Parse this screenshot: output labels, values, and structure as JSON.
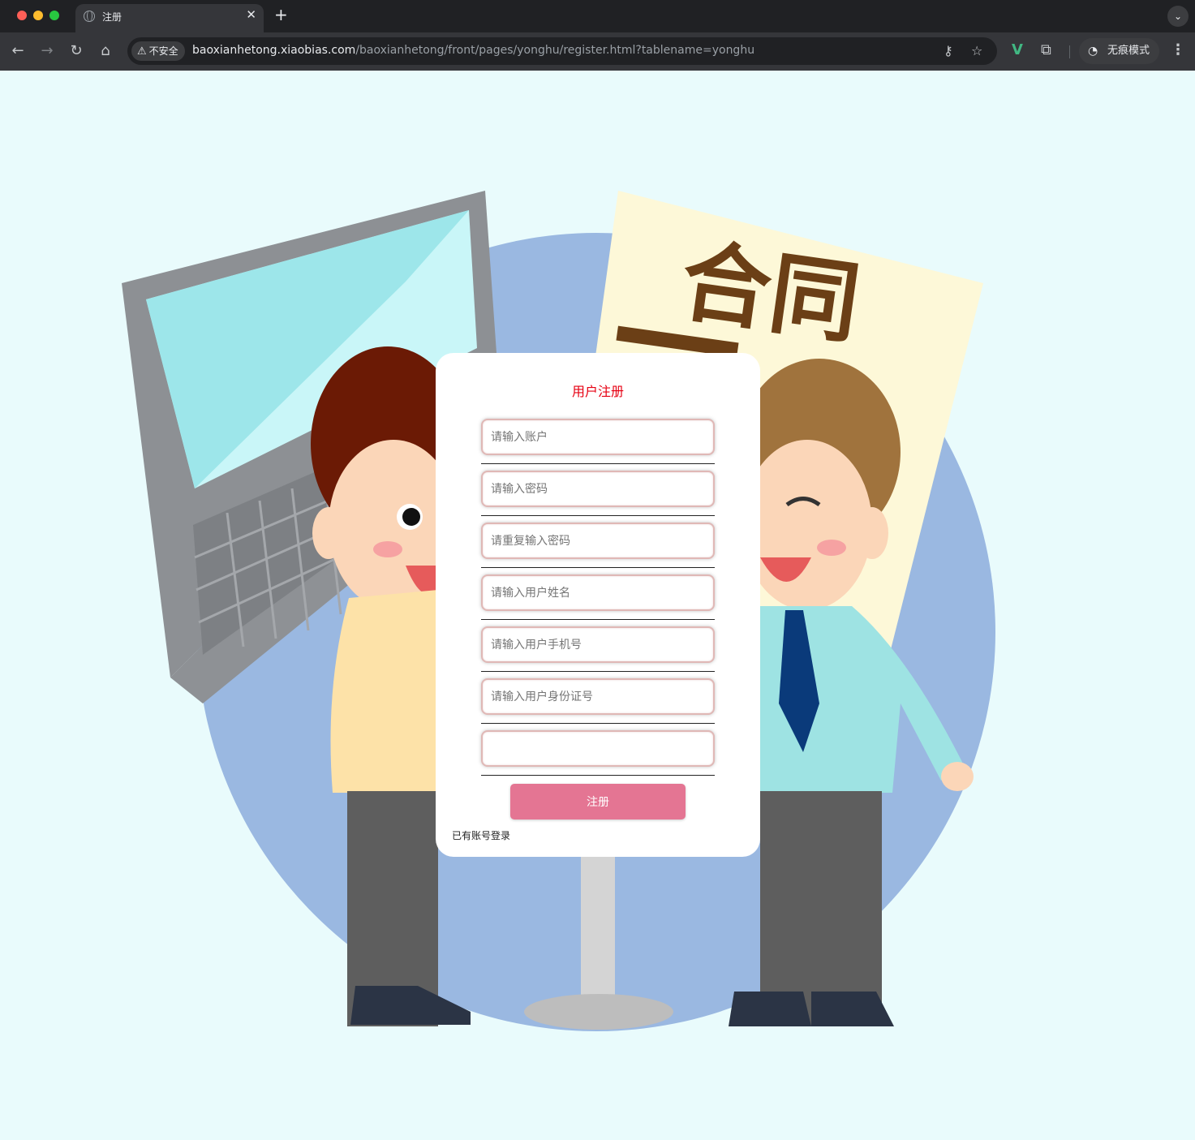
{
  "browser": {
    "tab_title": "注册",
    "tab_close": "✕",
    "new_tab": "+",
    "tab_menu": "⌄",
    "security_label": "不安全",
    "security_icon": "warning-triangle-icon",
    "url_host": "baoxianhetong.xiaobias.com",
    "url_path": "/baoxianhetong/front/pages/yonghu/register.html?tablename=yonghu",
    "incognito_label": "无痕模式",
    "nav": {
      "back": "←",
      "forward": "→",
      "reload": "↻",
      "home": "⌂"
    },
    "icons": [
      "key-icon",
      "star-icon",
      "vue-devtools-icon",
      "extensions-icon",
      "incognito-icon",
      "menu-icon"
    ]
  },
  "illustration": {
    "sign_text": "合同"
  },
  "register": {
    "title": "用户注册",
    "fields": [
      {
        "placeholder": "请输入账户",
        "value": ""
      },
      {
        "placeholder": "请输入密码",
        "value": ""
      },
      {
        "placeholder": "请重复输入密码",
        "value": ""
      },
      {
        "placeholder": "请输入用户姓名",
        "value": ""
      },
      {
        "placeholder": "请输入用户手机号",
        "value": ""
      },
      {
        "placeholder": "请输入用户身份证号",
        "value": ""
      },
      {
        "placeholder": "",
        "value": ""
      }
    ],
    "submit_label": "注册",
    "login_link": "已有账号登录"
  },
  "colors": {
    "title_red": "#e60012",
    "button_pink": "#e47593",
    "page_bg": "#e9fbfc",
    "circle_blue": "#9ab8e1"
  }
}
